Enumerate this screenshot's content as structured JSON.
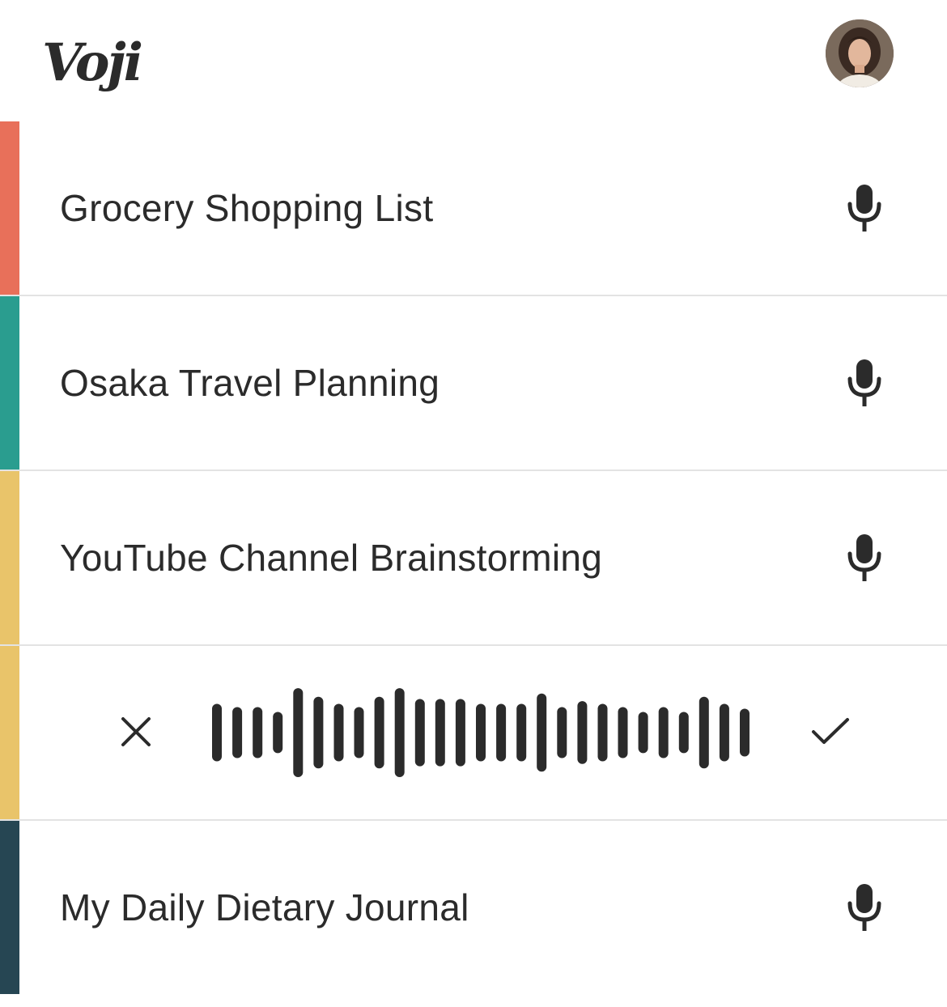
{
  "app": {
    "logo_text": "Voji"
  },
  "colors": {
    "coral": "#E8705A",
    "teal": "#2A9D8F",
    "mustard": "#E9C46A",
    "navy": "#264653",
    "text": "#2B2B2B",
    "divider": "#E3E3E3"
  },
  "icons": {
    "mic": "microphone-icon",
    "cancel": "close-icon",
    "confirm": "check-icon",
    "avatar": "user-avatar"
  },
  "notes": [
    {
      "title": "Grocery Shopping List",
      "color": "#E8705A"
    },
    {
      "title": "Osaka Travel Planning",
      "color": "#2A9D8F"
    },
    {
      "title": "YouTube Channel Brainstorming",
      "color": "#E9C46A"
    },
    {
      "title": "My Daily Dietary Journal",
      "color": "#264653"
    }
  ],
  "recording": {
    "color": "#E9C46A",
    "levels": [
      0.53,
      0.47,
      0.47,
      0.38,
      0.82,
      0.66,
      0.53,
      0.47,
      0.66,
      0.82,
      0.62,
      0.62,
      0.62,
      0.53,
      0.53,
      0.53,
      0.72,
      0.47,
      0.58,
      0.53,
      0.47,
      0.38,
      0.47,
      0.38,
      0.66,
      0.53,
      0.44
    ]
  }
}
